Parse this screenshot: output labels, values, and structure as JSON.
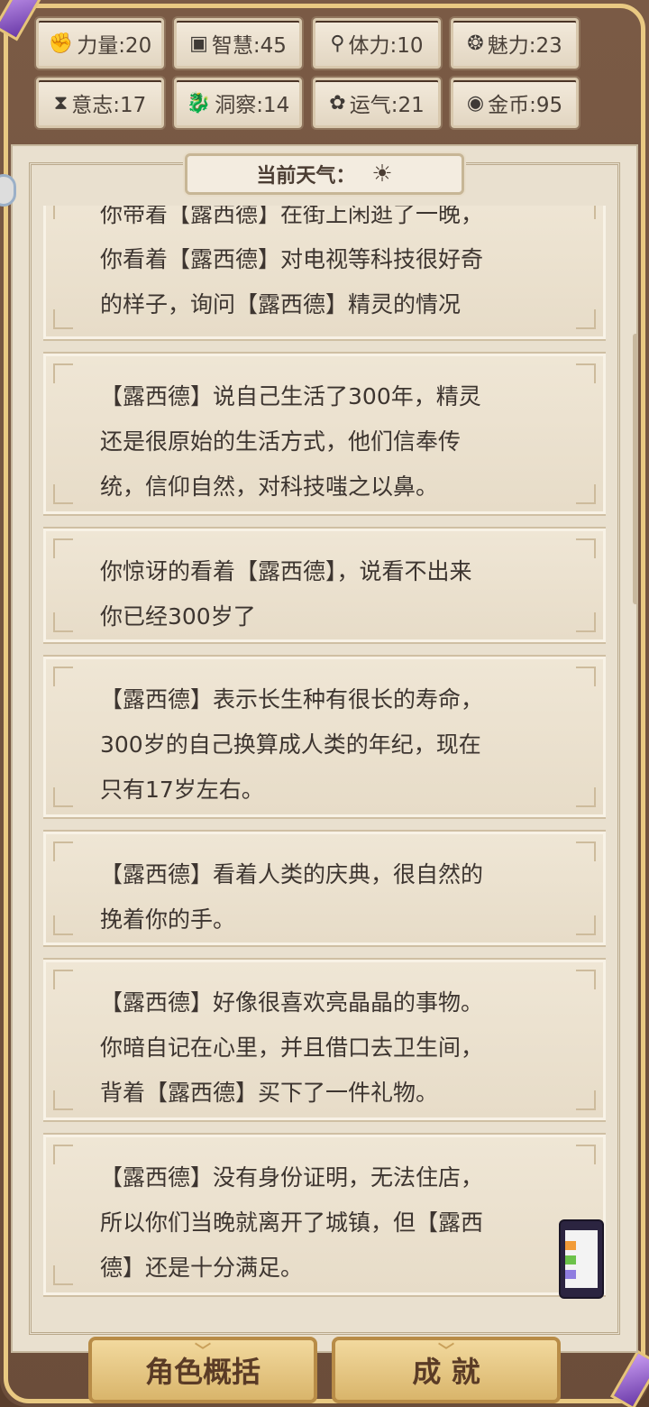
{
  "stats": [
    {
      "icon": "fist-icon",
      "glyph": "✊",
      "label": "力量:20"
    },
    {
      "icon": "book-icon",
      "glyph": "▣",
      "label": "智慧:45"
    },
    {
      "icon": "person-icon",
      "glyph": "⚲",
      "label": "体力:10"
    },
    {
      "icon": "charm-icon",
      "glyph": "❂",
      "label": "魅力:23"
    },
    {
      "icon": "hourglass-icon",
      "glyph": "⧗",
      "label": "意志:17"
    },
    {
      "icon": "dragon-icon",
      "glyph": "🐉",
      "label": "洞察:14"
    },
    {
      "icon": "flower-icon",
      "glyph": "✿",
      "label": "运气:21"
    },
    {
      "icon": "coin-icon",
      "glyph": "◉",
      "label": "金币:95"
    }
  ],
  "weather": {
    "label": "当前天气：",
    "icon": "sun-icon",
    "glyph": "☀"
  },
  "cards": [
    {
      "text": "你带着【露西德】在街上闲逛了一晚，\n你看着【露西德】对电视等科技很好奇\n的样子，询问【露西德】精灵的情况"
    },
    {
      "text": "【露西德】说自己生活了300年，精灵\n还是很原始的生活方式，他们信奉传\n统，信仰自然，对科技嗤之以鼻。"
    },
    {
      "text": "你惊讶的看着【露西德】，说看不出来\n你已经300岁了"
    },
    {
      "text": "【露西德】表示长生种有很长的寿命，\n300岁的自己换算成人类的年纪，现在\n只有17岁左右。"
    },
    {
      "text": "【露西德】看着人类的庆典，很自然的\n挽着你的手。"
    },
    {
      "text": "【露西德】好像很喜欢亮晶晶的事物。\n你暗自记在心里，并且借口去卫生间，\n背着【露西德】买下了一件礼物。"
    },
    {
      "text": "【露西德】没有身份证明，无法住店，\n所以你们当晚就离开了城镇，但【露西\n德】还是十分满足。"
    }
  ],
  "buttons": {
    "summary": "角色概括",
    "achievements": "成 就"
  }
}
